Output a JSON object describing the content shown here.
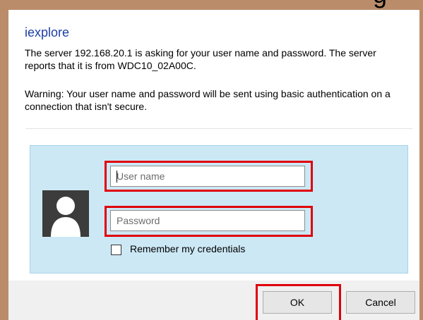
{
  "dialog": {
    "title": "iexplore",
    "message": "The server 192.168.20.1 is asking for your user name and password. The server reports that it is from WDC10_02A00C.",
    "warning": "Warning: Your user name and password will be sent using basic authentication on a connection that isn't secure.",
    "fragment": "g"
  },
  "form": {
    "username_placeholder": "User name",
    "password_placeholder": "Password",
    "remember_label": "Remember my credentials",
    "remember_checked": false
  },
  "buttons": {
    "ok": "OK",
    "cancel": "Cancel"
  },
  "colors": {
    "title": "#1e3ea5",
    "panel": "#cce8f5",
    "highlight": "#e0000b",
    "frame": "#ba8c6a"
  },
  "icons": {
    "avatar": "user-avatar-icon"
  }
}
